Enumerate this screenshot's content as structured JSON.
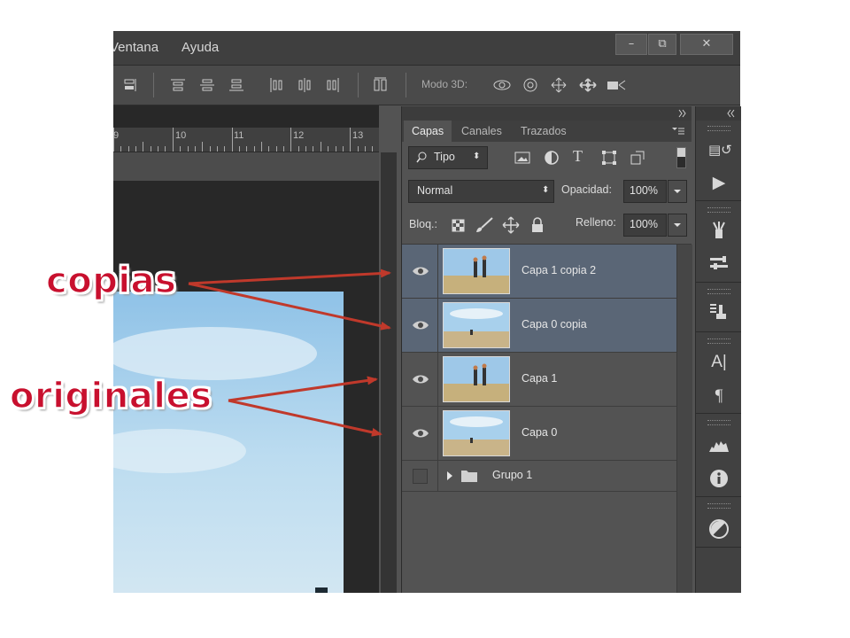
{
  "menu": {
    "items": [
      "Ventana",
      "Ayuda"
    ]
  },
  "window_controls": {
    "minimize": "–",
    "restore": "⧉",
    "close": "✕"
  },
  "optionsbar": {
    "mode3d_label": "Modo 3D:"
  },
  "ruler": {
    "ticks": [
      "9",
      "10",
      "11",
      "12",
      "13"
    ]
  },
  "layers_panel": {
    "tabs": [
      "Capas",
      "Canales",
      "Trazados"
    ],
    "active_tab": "Capas",
    "filter": {
      "label": "Tipo"
    },
    "blend_mode": "Normal",
    "opacity": {
      "label": "Opacidad:",
      "value": "100%"
    },
    "lock": {
      "label": "Bloq.:"
    },
    "fill": {
      "label": "Relleno:",
      "value": "100%"
    },
    "layers": [
      {
        "name": "Capa 1 copia 2",
        "selected": true,
        "visible": true
      },
      {
        "name": "Capa 0 copia",
        "selected": true,
        "visible": true
      },
      {
        "name": "Capa 1",
        "selected": false,
        "visible": true
      },
      {
        "name": "Capa 0",
        "selected": false,
        "visible": true
      }
    ],
    "group": {
      "name": "Grupo 1"
    }
  },
  "annotations": {
    "copias": "copias",
    "originales": "originales"
  },
  "colors": {
    "annotation": "#c8102e",
    "selected_layer": "#5a6676",
    "panel_bg": "#535353"
  }
}
